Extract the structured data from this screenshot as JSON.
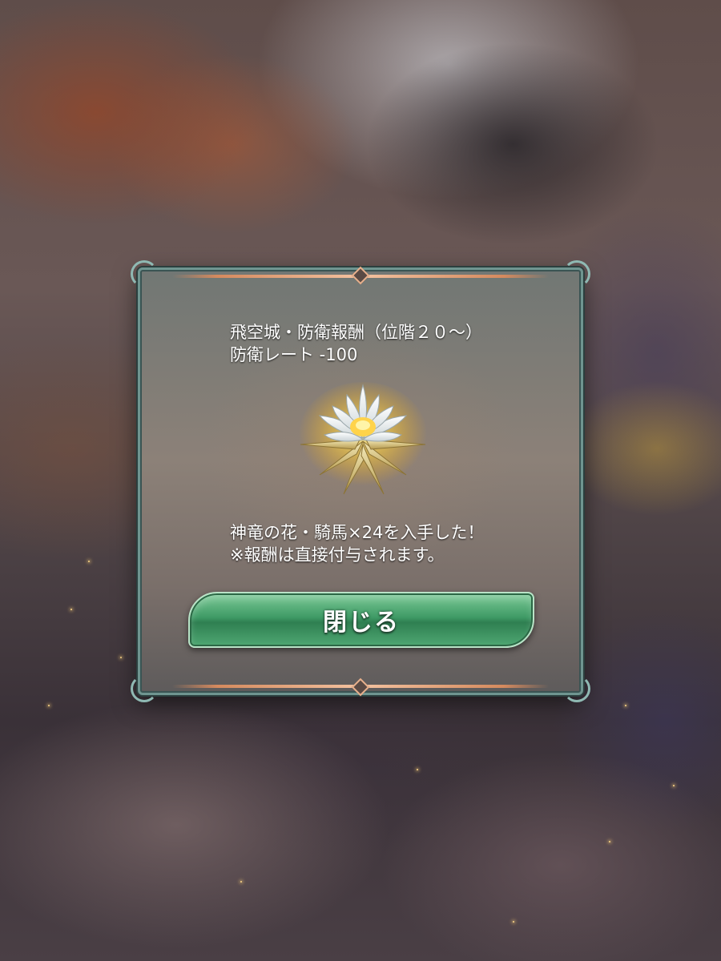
{
  "dialog": {
    "title_line1": "飛空城・防衛報酬（位階２０～）",
    "title_line2": "防衛レート -100",
    "reward_line1": "神竜の花・騎馬×24を入手した！",
    "reward_line2": "※報酬は直接付与されます。",
    "close_label": "閉じる"
  },
  "icons": {
    "reward_item": "divine-dragon-flower-icon"
  },
  "colors": {
    "button_green": "#3f9b66",
    "frame_teal": "#6f9590",
    "band_copper": "#d58a5e",
    "flower_gold": "#ffd34a"
  }
}
